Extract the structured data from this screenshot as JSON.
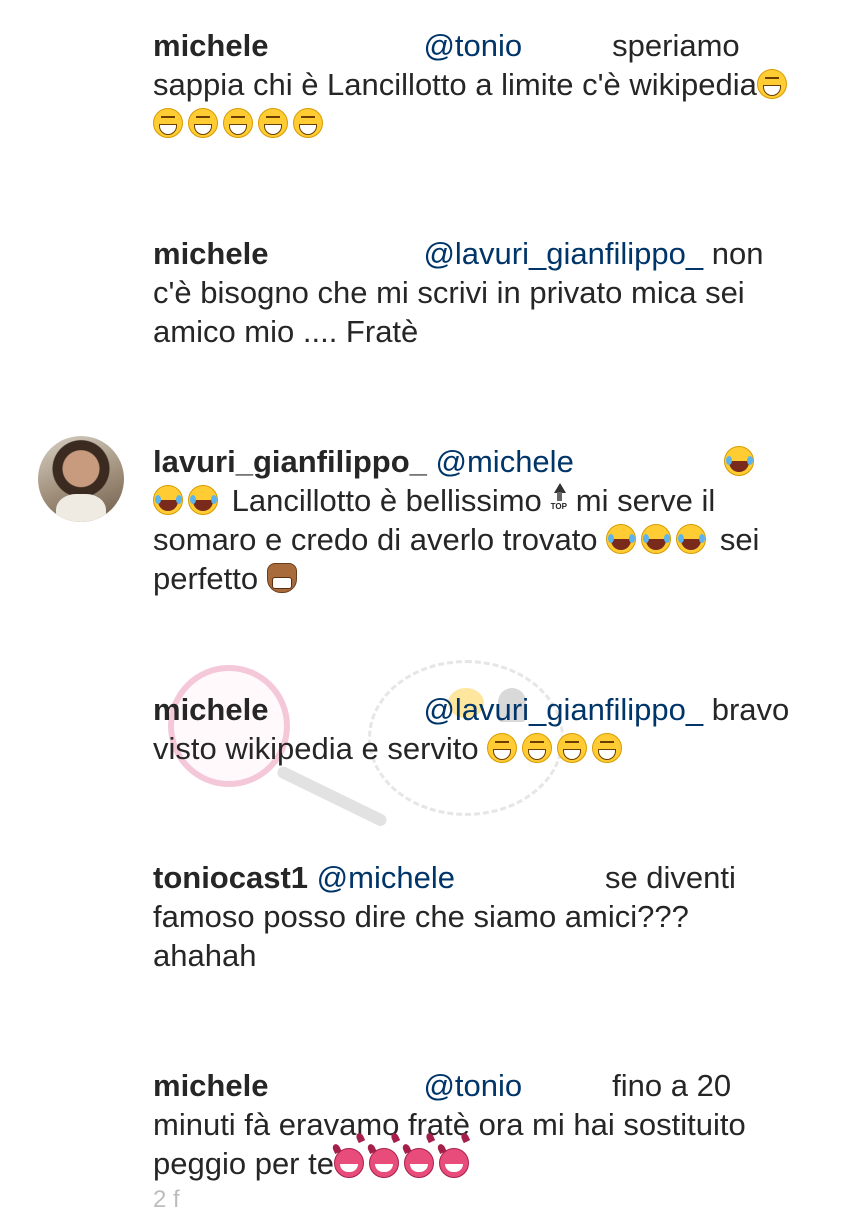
{
  "comments": [
    {
      "user": "michele",
      "mention": "@tonio",
      "text1": "speriamo sappia chi è Lancillotto a limite c'è wikipedia",
      "emojis": [
        "grin",
        "grin",
        "grin",
        "grin",
        "grin",
        "grin"
      ]
    },
    {
      "user": "michele",
      "mention": "@lavuri_gianfilippo_",
      "text1": "non c'è bisogno che mi scrivi in privato mica sei amico mio .... Fratè"
    },
    {
      "user": "lavuri_gianfilippo_",
      "mention": "@michele",
      "text1": "Lancillotto è bellissimo",
      "text2": "mi serve il somaro e credo di averlo trovato",
      "text3": "sei perfetto",
      "avatar": "user-avatar"
    },
    {
      "user": "michele",
      "mention": "@lavuri_gianfilippo_",
      "text1": "bravo visto wikipedia e servito",
      "emojis": [
        "grin",
        "grin",
        "grin",
        "grin"
      ]
    },
    {
      "user": "toniocast1",
      "mention": "@michele",
      "text1": "se diventi famoso posso dire che siamo amici??? ahahah"
    },
    {
      "user": "michele",
      "mention": "@tonio",
      "text1": "fino a 20 minuti fà eravamo fratè ora mi hai sostituito peggio per te",
      "emojis": [
        "devil",
        "devil",
        "devil",
        "devil"
      ]
    }
  ],
  "footer_partial": "2     f",
  "colors": {
    "text": "#262626",
    "mention": "#003569",
    "background": "#ffffff"
  },
  "icons": [
    "grinning-squinting-face-icon",
    "tears-of-joy-face-icon",
    "top-arrow-icon",
    "horse-face-icon",
    "smiling-devil-icon"
  ]
}
